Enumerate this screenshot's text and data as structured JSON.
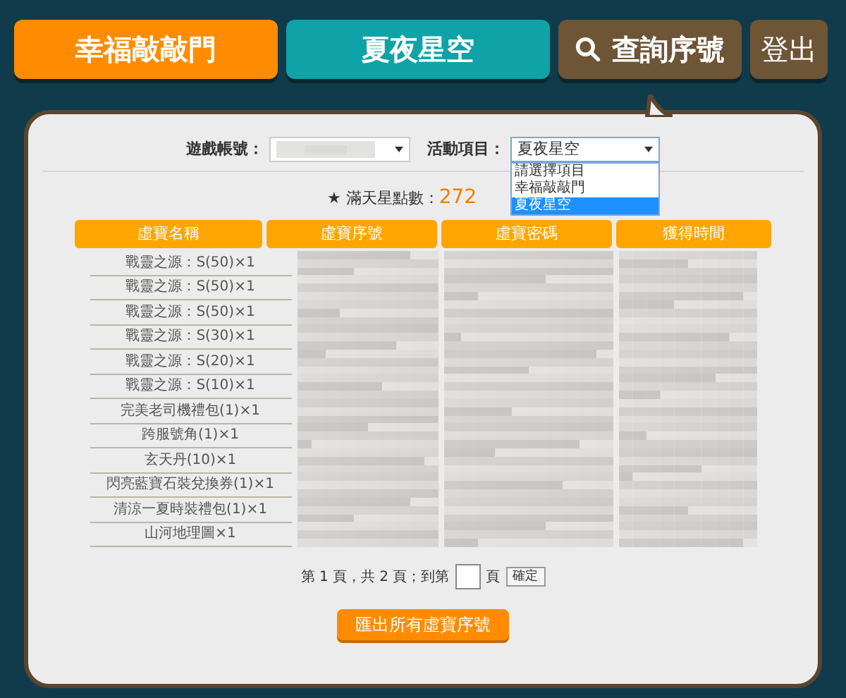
{
  "nav": [
    {
      "label": "幸福敲敲門",
      "kind": "event",
      "color": "#ff8c00"
    },
    {
      "label": "夏夜星空",
      "kind": "event",
      "color": "#0fa3a8"
    },
    {
      "label": "查詢序號",
      "kind": "search"
    },
    {
      "label": "登出",
      "kind": "logout"
    }
  ],
  "filters": {
    "account_label": "遊戲帳號：",
    "event_label": "活動項目：",
    "event_value": "夏夜星空",
    "event_options": [
      {
        "label": "請選擇項目",
        "selected": false
      },
      {
        "label": "幸福敲敲門",
        "selected": false
      },
      {
        "label": "夏夜星空",
        "selected": true
      }
    ]
  },
  "points": {
    "label": "★ 滿天星點數：",
    "value": "272"
  },
  "table": {
    "columns": [
      "虛寶名稱",
      "虛寶序號",
      "虛寶密碼",
      "獲得時間"
    ],
    "rows": [
      {
        "name": "戰靈之源：S(50)×1"
      },
      {
        "name": "戰靈之源：S(50)×1"
      },
      {
        "name": "戰靈之源：S(50)×1"
      },
      {
        "name": "戰靈之源：S(30)×1"
      },
      {
        "name": "戰靈之源：S(20)×1"
      },
      {
        "name": "戰靈之源：S(10)×1"
      },
      {
        "name": "完美老司機禮包(1)×1"
      },
      {
        "name": "跨服號角(1)×1"
      },
      {
        "name": "玄天丹(10)×1"
      },
      {
        "name": "閃亮藍寶石裝兌換券(1)×1"
      },
      {
        "name": "清涼一夏時裝禮包(1)×1"
      },
      {
        "name": "山河地理圖×1"
      }
    ]
  },
  "pager": {
    "before": "第 1 頁，共 2 頁；到第",
    "after": "頁",
    "confirm": "確定"
  },
  "export_button": "匯出所有虛寶序號"
}
